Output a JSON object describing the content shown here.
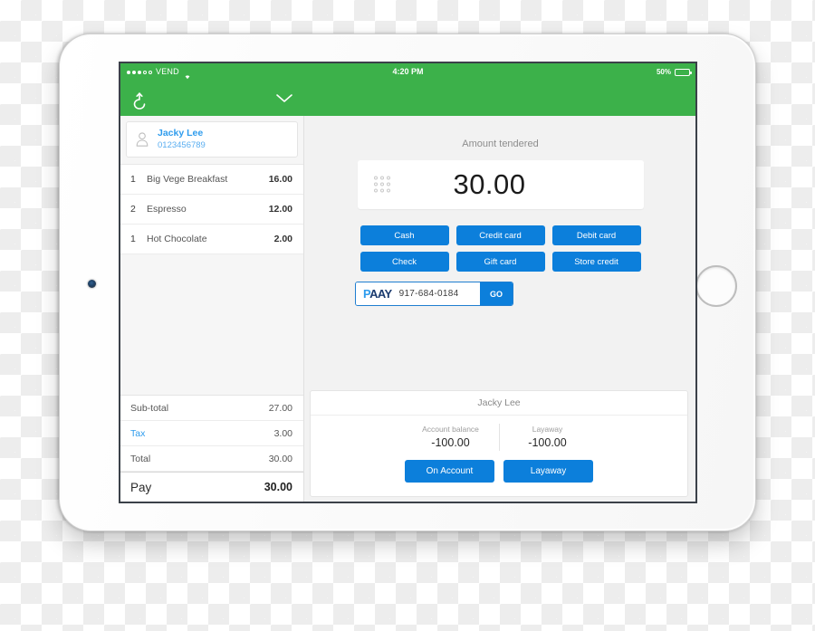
{
  "status_bar": {
    "signal_dots_filled": 3,
    "signal_dots_empty": 2,
    "carrier": "VEND",
    "wifi_icon": "wifi-icon",
    "time": "4:20 PM",
    "battery_percent": "50%",
    "battery_level": 50
  },
  "navbar": {
    "back_icon": "undo-arrow-icon",
    "chevron_icon": "chevron-down-icon"
  },
  "cart": {
    "customer": {
      "icon": "person-icon",
      "name": "Jacky Lee",
      "phone": "0123456789"
    },
    "line_items": [
      {
        "qty": "1",
        "name": "Big Vege Breakfast",
        "price": "16.00"
      },
      {
        "qty": "2",
        "name": "Espresso",
        "price": "12.00"
      },
      {
        "qty": "1",
        "name": "Hot Chocolate",
        "price": "2.00"
      }
    ],
    "totals": [
      {
        "label": "Sub-total",
        "value": "27.00"
      },
      {
        "label": "Tax",
        "value": "3.00"
      },
      {
        "label": "Total",
        "value": "30.00"
      }
    ],
    "pay": {
      "label": "Pay",
      "value": "30.00"
    }
  },
  "payment": {
    "tender_label": "Amount tendered",
    "keypad_icon": "keypad-grid-icon",
    "amount": "30.00",
    "methods": [
      "Cash",
      "Credit card",
      "Debit card",
      "Check",
      "Gift card",
      "Store credit"
    ],
    "paay": {
      "logo_p": "P",
      "logo_aay": "AAY",
      "phone": "917-684-0184",
      "go_label": "GO"
    }
  },
  "customer_panel": {
    "title": "Jacky Lee",
    "balances": [
      {
        "label": "Account balance",
        "value": "-100.00"
      },
      {
        "label": "Layaway",
        "value": "-100.00"
      }
    ],
    "actions": [
      "On Account",
      "Layaway"
    ]
  },
  "colors": {
    "green": "#3cb14a",
    "blue": "#0c7fdb",
    "link_blue": "#2f9ced",
    "paay_navy": "#1b3b6f"
  }
}
